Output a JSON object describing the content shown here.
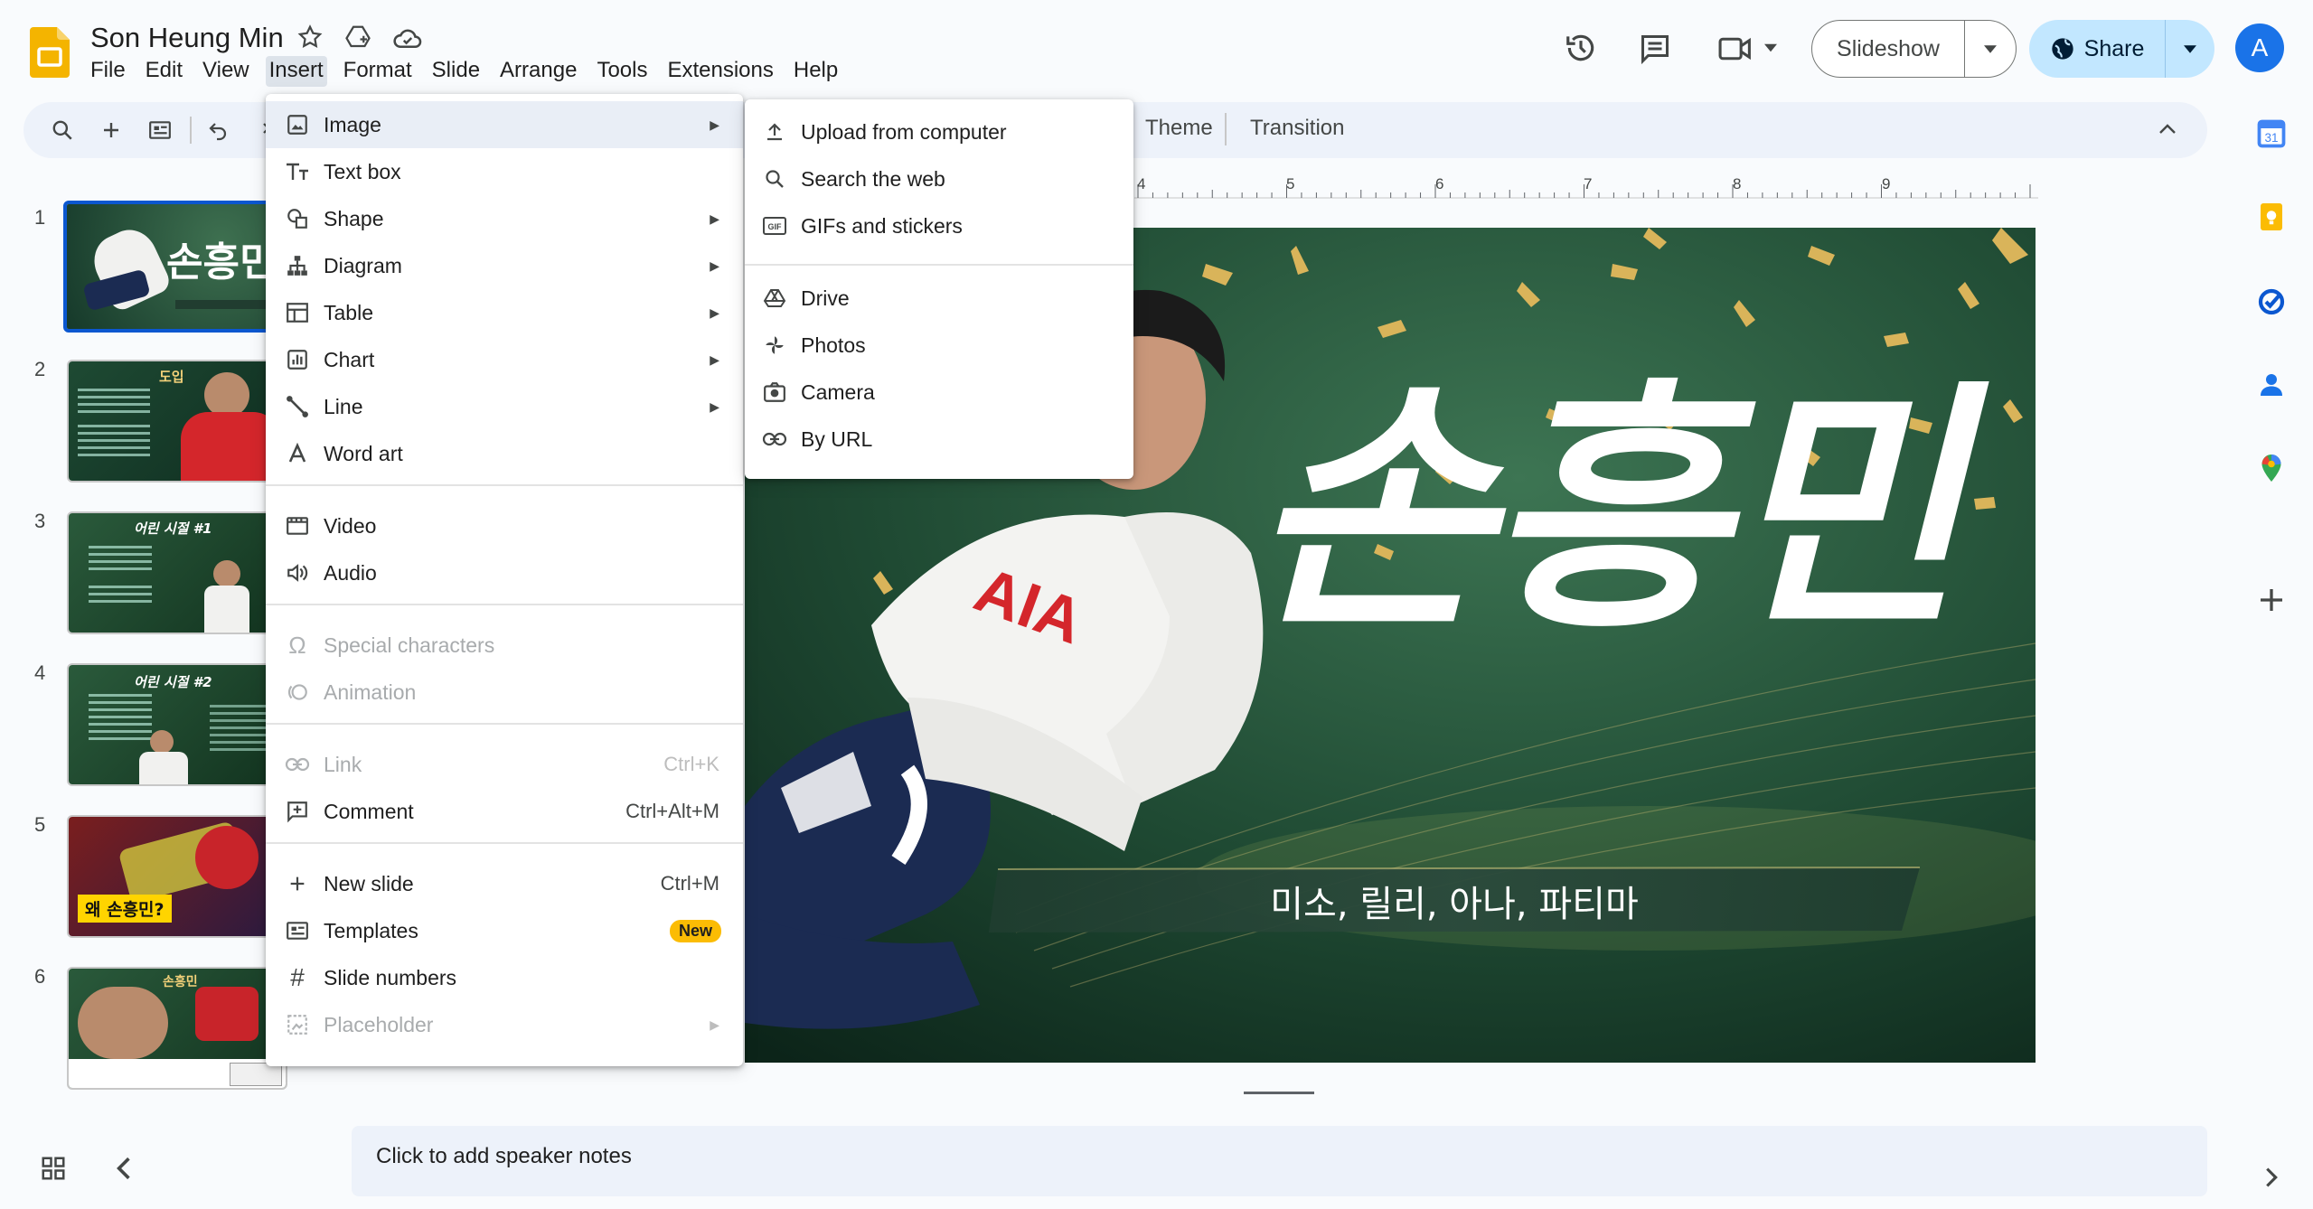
{
  "app": {
    "doc_title": "Son Heung Min",
    "menus": [
      "File",
      "Edit",
      "View",
      "Insert",
      "Format",
      "Slide",
      "Arrange",
      "Tools",
      "Extensions",
      "Help"
    ],
    "active_menu": "Insert"
  },
  "header": {
    "slideshow_label": "Slideshow",
    "share_label": "Share",
    "avatar_letter": "A"
  },
  "toolbar": {
    "theme_label": "Theme",
    "transition_label": "Transition"
  },
  "ruler": {
    "ticks": [
      "4",
      "5",
      "6",
      "7",
      "8",
      "9"
    ]
  },
  "filmstrip": {
    "slides": [
      {
        "num": "1",
        "title": "손흥민",
        "selected": true
      },
      {
        "num": "2",
        "title": "도입"
      },
      {
        "num": "3",
        "title": "어린 시절 #1"
      },
      {
        "num": "4",
        "title": "어린 시절 #2"
      },
      {
        "num": "5",
        "title": "왜 손흥민?"
      },
      {
        "num": "6",
        "title": "손흥민"
      }
    ]
  },
  "slide": {
    "title": "손흥민",
    "subtitle": "미소, 릴리, 아나, 파티마",
    "colors": {
      "bg": "#1f4a33",
      "bg_dark": "#0f2a1d",
      "confetti": "#d9b45a"
    }
  },
  "notes": {
    "placeholder": "Click to add speaker notes"
  },
  "insert_menu": {
    "items": [
      {
        "label": "Image",
        "icon": "image-icon",
        "submenu": true,
        "highlighted": true
      },
      {
        "label": "Text box",
        "icon": "text-box-icon"
      },
      {
        "label": "Shape",
        "icon": "shape-icon",
        "submenu": true
      },
      {
        "label": "Diagram",
        "icon": "diagram-icon",
        "submenu": true
      },
      {
        "label": "Table",
        "icon": "table-icon",
        "submenu": true
      },
      {
        "label": "Chart",
        "icon": "chart-icon",
        "submenu": true
      },
      {
        "label": "Line",
        "icon": "line-icon",
        "submenu": true
      },
      {
        "label": "Word art",
        "icon": "word-art-icon"
      },
      {
        "label": "Video",
        "icon": "video-icon"
      },
      {
        "label": "Audio",
        "icon": "audio-icon"
      },
      {
        "label": "Special characters",
        "icon": "omega-icon",
        "disabled": true
      },
      {
        "label": "Animation",
        "icon": "animation-icon",
        "disabled": true
      },
      {
        "label": "Link",
        "icon": "link-icon",
        "shortcut": "Ctrl+K",
        "disabled": true
      },
      {
        "label": "Comment",
        "icon": "comment-add-icon",
        "shortcut": "Ctrl+Alt+M"
      },
      {
        "label": "New slide",
        "icon": "plus-icon",
        "shortcut": "Ctrl+M"
      },
      {
        "label": "Templates",
        "icon": "templates-icon",
        "badge": "New"
      },
      {
        "label": "Slide numbers",
        "icon": "hash-icon"
      },
      {
        "label": "Placeholder",
        "icon": "placeholder-icon",
        "submenu": true,
        "disabled": true
      }
    ]
  },
  "image_submenu": {
    "items": [
      {
        "label": "Upload from computer",
        "icon": "upload-icon"
      },
      {
        "label": "Search the web",
        "icon": "search-icon"
      },
      {
        "label": "GIFs and stickers",
        "icon": "gif-icon"
      },
      {
        "label": "Drive",
        "icon": "drive-icon"
      },
      {
        "label": "Photos",
        "icon": "photos-icon"
      },
      {
        "label": "Camera",
        "icon": "camera-icon"
      },
      {
        "label": "By URL",
        "icon": "link-icon"
      }
    ]
  }
}
